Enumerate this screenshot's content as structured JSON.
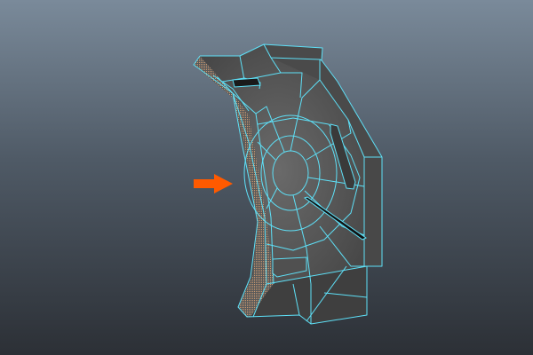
{
  "viewport": {
    "background_top": "#7a8a9a",
    "background_bottom": "#2c3036",
    "wireframe_color": "#5ee0f7",
    "mesh_color": "#555555",
    "selected_faces_color": "#c89870",
    "arrow_color": "#ff5a00",
    "arrow_icon": "arrow-right-icon"
  }
}
